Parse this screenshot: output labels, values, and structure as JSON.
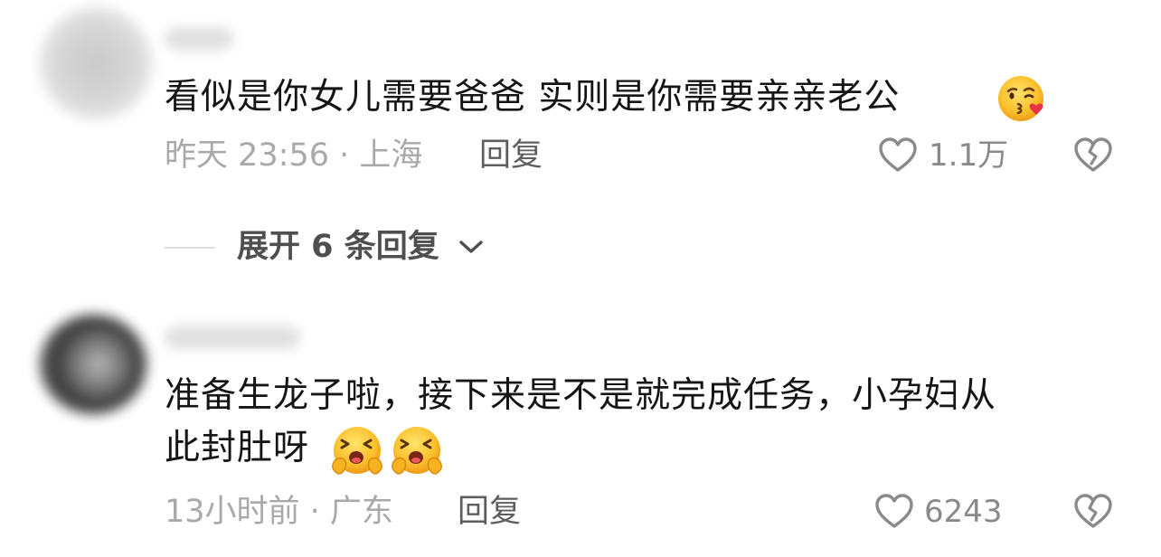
{
  "comments": [
    {
      "text": "看似是你女儿需要爸爸 实则是你需要亲亲老公",
      "emoji": "kissing-face-emoji",
      "time_location": "昨天 23:56 · 上海",
      "reply_label": "回复",
      "like_count": "1.1万",
      "expand_replies": "展开 6 条回复"
    },
    {
      "text_line1": "准备生龙子啦，接下来是不是就完成任务，小孕妇从",
      "text_line2": "此封肚呀",
      "emojis": [
        "laughing-emoji",
        "laughing-emoji"
      ],
      "time_location": "13小时前 · 广东",
      "reply_label": "回复",
      "like_count": "6243"
    }
  ],
  "icons": {
    "like": "heart-outline-icon",
    "dislike": "broken-heart-icon",
    "expand": "chevron-down-icon"
  },
  "colors": {
    "text_primary": "#151515",
    "text_meta": "#a9a9a9",
    "reply": "#5e5e5e",
    "icon_stroke": "#8a8a8a"
  }
}
